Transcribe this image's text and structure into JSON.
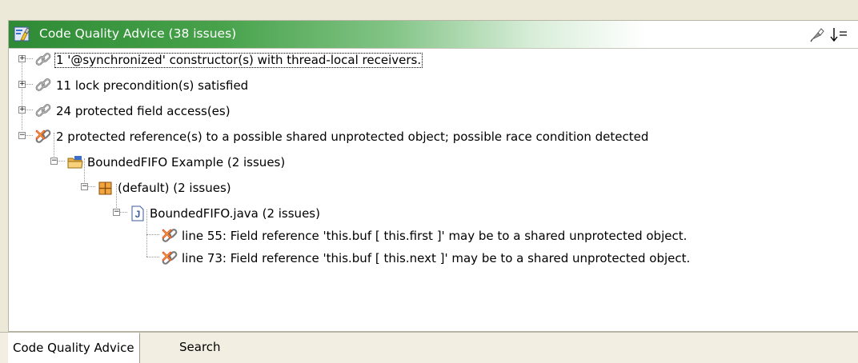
{
  "view": {
    "title": "Code Quality Advice (38 issues)",
    "title_icon": "code-quality-advice-icon",
    "toolbar": [
      "pin-icon",
      "sort-icon"
    ]
  },
  "tree": {
    "items": [
      {
        "label": "1 '@synchronized' constructor(s) with thread-local receivers.",
        "icon": "chain-link-icon",
        "expanded": false
      },
      {
        "label": "11 lock precondition(s) satisfied",
        "icon": "chain-link-icon",
        "expanded": false
      },
      {
        "label": "24 protected field access(es)",
        "icon": "chain-link-icon",
        "expanded": false
      },
      {
        "label": "2 protected reference(s) to a possible shared unprotected object; possible race condition detected",
        "icon": "race-condition-icon",
        "expanded": true
      },
      {
        "label": "BoundedFIFO Example (2 issues)",
        "icon": "project-folder-icon",
        "expanded": true
      },
      {
        "label": "(default) (2 issues)",
        "icon": "package-icon",
        "expanded": true
      },
      {
        "label": "BoundedFIFO.java (2 issues)",
        "icon": "java-file-icon",
        "expanded": true
      },
      {
        "label": "line 55: Field reference 'this.buf [ this.first ]' may be to a shared unprotected object.",
        "icon": "race-condition-icon"
      },
      {
        "label": "line 73: Field reference 'this.buf [ this.next ]' may be to a shared unprotected object.",
        "icon": "race-condition-icon"
      }
    ]
  },
  "tabs": [
    {
      "label": "Code Quality Advice",
      "active": true
    },
    {
      "label": "Search",
      "active": false
    }
  ],
  "colors": {
    "title_green": "#2f8a35",
    "selection_outline": "#000000"
  }
}
